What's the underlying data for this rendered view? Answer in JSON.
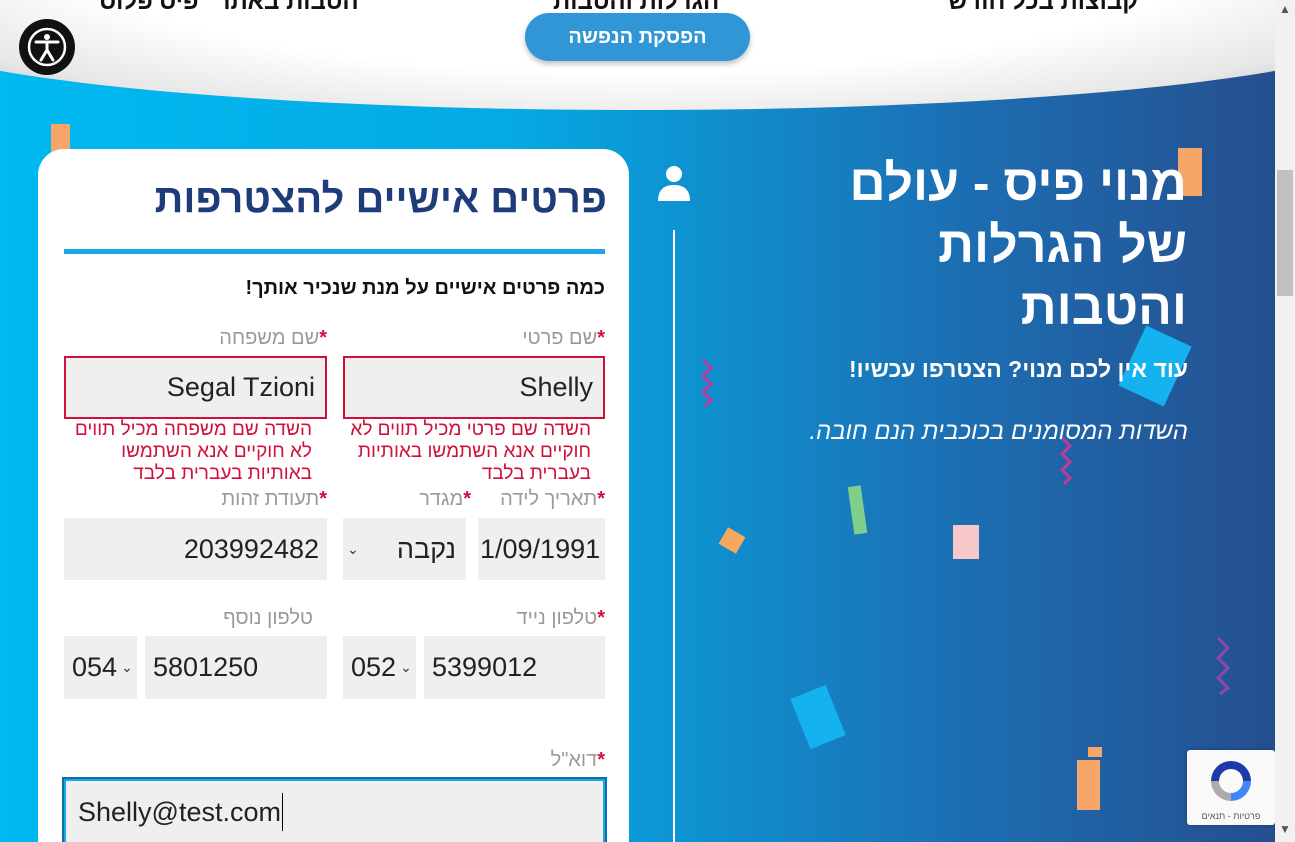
{
  "top_nav": {
    "link_right": "קבוצות בכל חודש",
    "link_center": "הגרלות והטבות",
    "link_left": "הטבות באתר \"פיס פלוס\"",
    "stop_gambling_button": "הפסקת הנפשה"
  },
  "hero": {
    "title_line1": "מנוי פיס - עולם",
    "title_line2": "של הגרלות",
    "title_line3": "והטבות",
    "subtitle": "עוד אין לכם מנוי? הצטרפו עכשיו!",
    "note": "השדות המסומנים בכוכבית הנם חובה."
  },
  "form": {
    "title": "פרטים אישיים להצטרפות",
    "subtitle": "כמה פרטים אישיים על מנת שנכיר אותך!",
    "required_mark": "*",
    "first_name": {
      "label": "שם פרטי",
      "value": "Shelly",
      "error": "השדה שם פרטי מכיל תווים לא חוקיים אנא השתמשו באותיות בעברית בלבד"
    },
    "last_name": {
      "label": "שם משפחה",
      "value": "Segal Tzioni",
      "error": "השדה שם משפחה מכיל תווים לא חוקיים אנא השתמשו באותיות בעברית בלבד"
    },
    "birth_date": {
      "label": "תאריך לידה",
      "value": "1/09/1991"
    },
    "gender": {
      "label": "מגדר",
      "value": "נקבה"
    },
    "id_number": {
      "label": "תעודת זהות",
      "value": "203992482"
    },
    "mobile_phone": {
      "label": "טלפון נייד",
      "prefix": "052",
      "number": "5399012"
    },
    "extra_phone": {
      "label": "טלפון נוסף",
      "prefix": "054",
      "number": "5801250"
    },
    "email": {
      "label": "דוא\"ל",
      "value": "Shelly@test.com"
    }
  },
  "recaptcha": {
    "links": "פרטיות - תנאים"
  },
  "colors": {
    "brand_dark": "#1f3c7a",
    "accent_blue": "#1aa7e3",
    "error_red": "#d0103a",
    "button_blue": "#3096d6"
  }
}
